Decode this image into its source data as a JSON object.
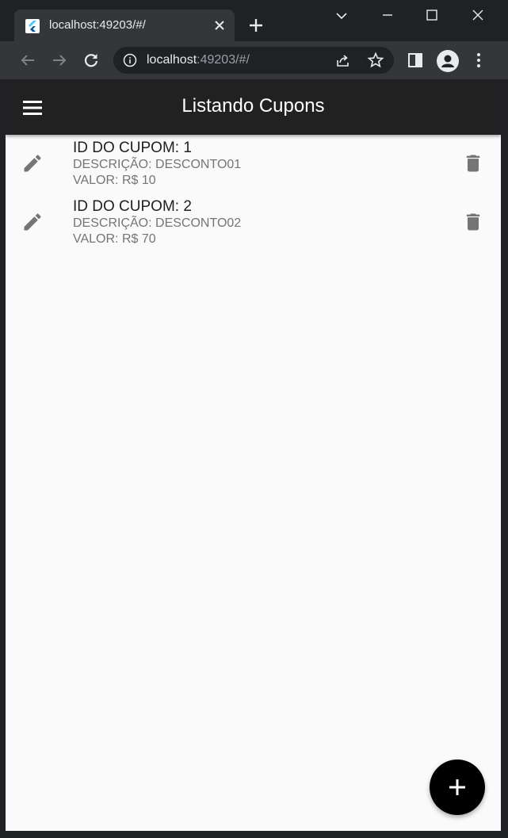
{
  "browser": {
    "tab_title": "localhost:49203/#/",
    "url_host": "localhost",
    "url_rest": ":49203/#/"
  },
  "app": {
    "title": "Listando Cupons",
    "coupons": [
      {
        "id_line": "ID DO CUPOM: 1",
        "description_line": "DESCRIÇÃO: DESCONTO01",
        "value_line": "VALOR: R$ 10"
      },
      {
        "id_line": "ID DO CUPOM: 2",
        "description_line": "DESCRIÇÃO: DESCONTO02",
        "value_line": "VALOR: R$ 70"
      }
    ]
  },
  "icons": {
    "menu": "hamburger-icon",
    "edit": "pencil-icon",
    "delete": "trash-icon",
    "fab": "plus-icon"
  },
  "colors": {
    "appbar": "#212121",
    "background": "#fafafa",
    "icon_gray": "#757575",
    "fab": "#000000"
  }
}
